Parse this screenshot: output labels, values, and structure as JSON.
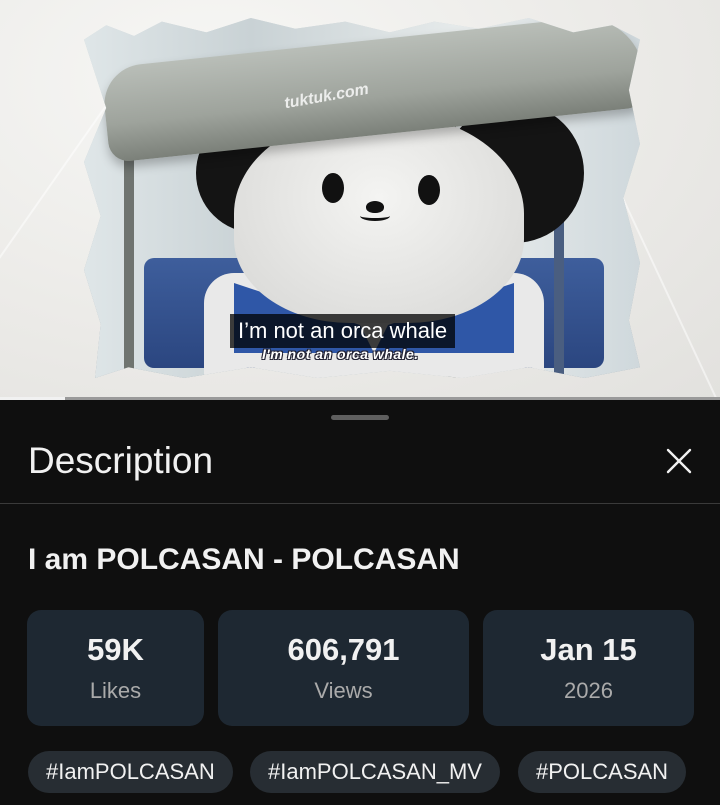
{
  "video": {
    "canopy_text": "tuktuk.com",
    "caption_main": "I’m not an orca whale",
    "caption_burned": "I'm not an orca whale.",
    "progress": 0.09
  },
  "panel": {
    "title": "Description",
    "close_icon": "close-icon"
  },
  "video_title": "I am POLCASAN - POLCASAN",
  "stats": [
    {
      "value": "59K",
      "label": "Likes"
    },
    {
      "value": "606,791",
      "label": "Views"
    },
    {
      "value": "Jan 15",
      "label": "2026"
    }
  ],
  "hashtags": [
    "#IamPOLCASAN",
    "#IamPOLCASAN_MV",
    "#POLCASAN"
  ]
}
